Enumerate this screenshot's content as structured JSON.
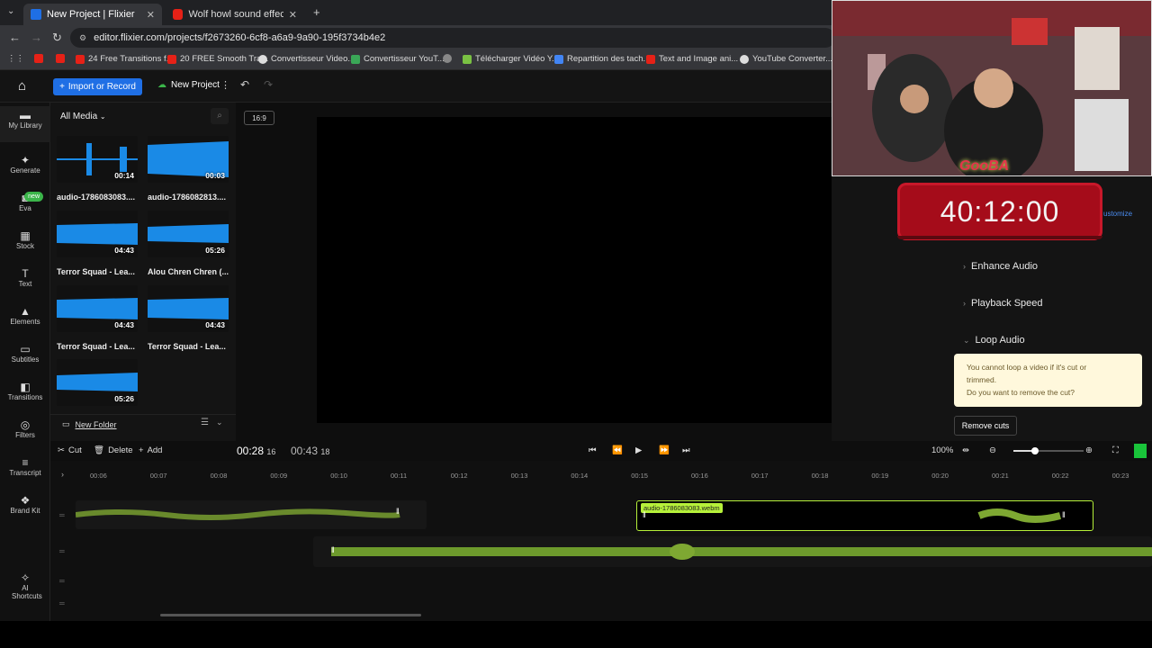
{
  "browser": {
    "tabs": [
      {
        "title": "New Project | Flixier",
        "active": true
      },
      {
        "title": "Wolf howl sound effect | night",
        "active": false
      }
    ],
    "new_tab_icon": "+",
    "url": "editor.flixier.com/projects/f2673260-6cf8-a6a9-9a90-195f3734b4e2"
  },
  "bookmarks": [
    {
      "label": "24 Free Transitions f...",
      "color": "#e62117"
    },
    {
      "label": "20 FREE Smooth Tra...",
      "color": "#e62117"
    },
    {
      "label": "Convertisseur Video...",
      "color": "#dddddd"
    },
    {
      "label": "Convertisseur YouT...",
      "color": "#3aa757"
    },
    {
      "label": "Télécharger Vidéo Y...",
      "color": "#7ac143"
    },
    {
      "label": "Repartition des tach...",
      "color": "#4285f4"
    },
    {
      "label": "Text and Image ani...",
      "color": "#e62117"
    },
    {
      "label": "YouTube Converter...",
      "color": "#dddddd"
    }
  ],
  "app": {
    "import_label": "Import or Record",
    "new_project_label": "New Project"
  },
  "rail": [
    {
      "label": "My Library",
      "icon": "folder-icon"
    },
    {
      "label": "Generate",
      "icon": "sparkle-icon"
    },
    {
      "label": "Eva",
      "icon": "robot-icon",
      "badge": "new"
    },
    {
      "label": "Stock",
      "icon": "grid-icon"
    },
    {
      "label": "Text",
      "icon": "text-icon"
    },
    {
      "label": "Elements",
      "icon": "shapes-icon"
    },
    {
      "label": "Subtitles",
      "icon": "subtitles-icon"
    },
    {
      "label": "Transitions",
      "icon": "transitions-icon"
    },
    {
      "label": "Filters",
      "icon": "filters-icon"
    },
    {
      "label": "Transcript",
      "icon": "transcript-icon"
    },
    {
      "label": "Brand Kit",
      "icon": "brandkit-icon"
    },
    {
      "label": "AI Shortcuts",
      "icon": "ai-icon"
    }
  ],
  "media": {
    "filter_label": "All Media",
    "items": [
      {
        "name": "audio-1786083083....",
        "duration": "00:14"
      },
      {
        "name": "audio-1786082813....",
        "duration": "00:03"
      },
      {
        "name": "Terror Squad - Lea...",
        "duration": "04:43"
      },
      {
        "name": "Alou Chren Chren (...",
        "duration": "05:26"
      },
      {
        "name": "Terror Squad - Lea...",
        "duration": "04:43"
      },
      {
        "name": "Terror Squad - Lea...",
        "duration": "04:43"
      },
      {
        "name": "",
        "duration": "05:26"
      }
    ],
    "new_folder_label": "New Folder"
  },
  "preview": {
    "aspect": "16:9"
  },
  "overlay": {
    "streamer_tag": "GooBA",
    "timer": "40:12:00"
  },
  "right_panel": {
    "customize_label": "ustomize",
    "sections": [
      "Enhance Audio",
      "Playback Speed",
      "Loop Audio"
    ],
    "loop_warning_line1": "You cannot loop a video if it's cut or",
    "loop_warning_line2": "trimmed.",
    "loop_warning_line3": "Do you want to remove the cut?",
    "remove_cuts_label": "Remove cuts"
  },
  "controls": {
    "cut_label": "Cut",
    "delete_label": "Delete",
    "add_label": "Add",
    "current_time": "00:28",
    "current_frame": "16",
    "total_time": "00:43",
    "total_frame": "18",
    "zoom": "100%"
  },
  "timeline": {
    "ticks": [
      "00:06",
      "00:07",
      "00:08",
      "00:09",
      "00:10",
      "00:11",
      "00:12",
      "00:13",
      "00:14",
      "00:15",
      "00:16",
      "00:17",
      "00:18",
      "00:19",
      "00:20",
      "00:21",
      "00:22",
      "00:23"
    ],
    "clip_name": "audio-1786083083.webm"
  }
}
